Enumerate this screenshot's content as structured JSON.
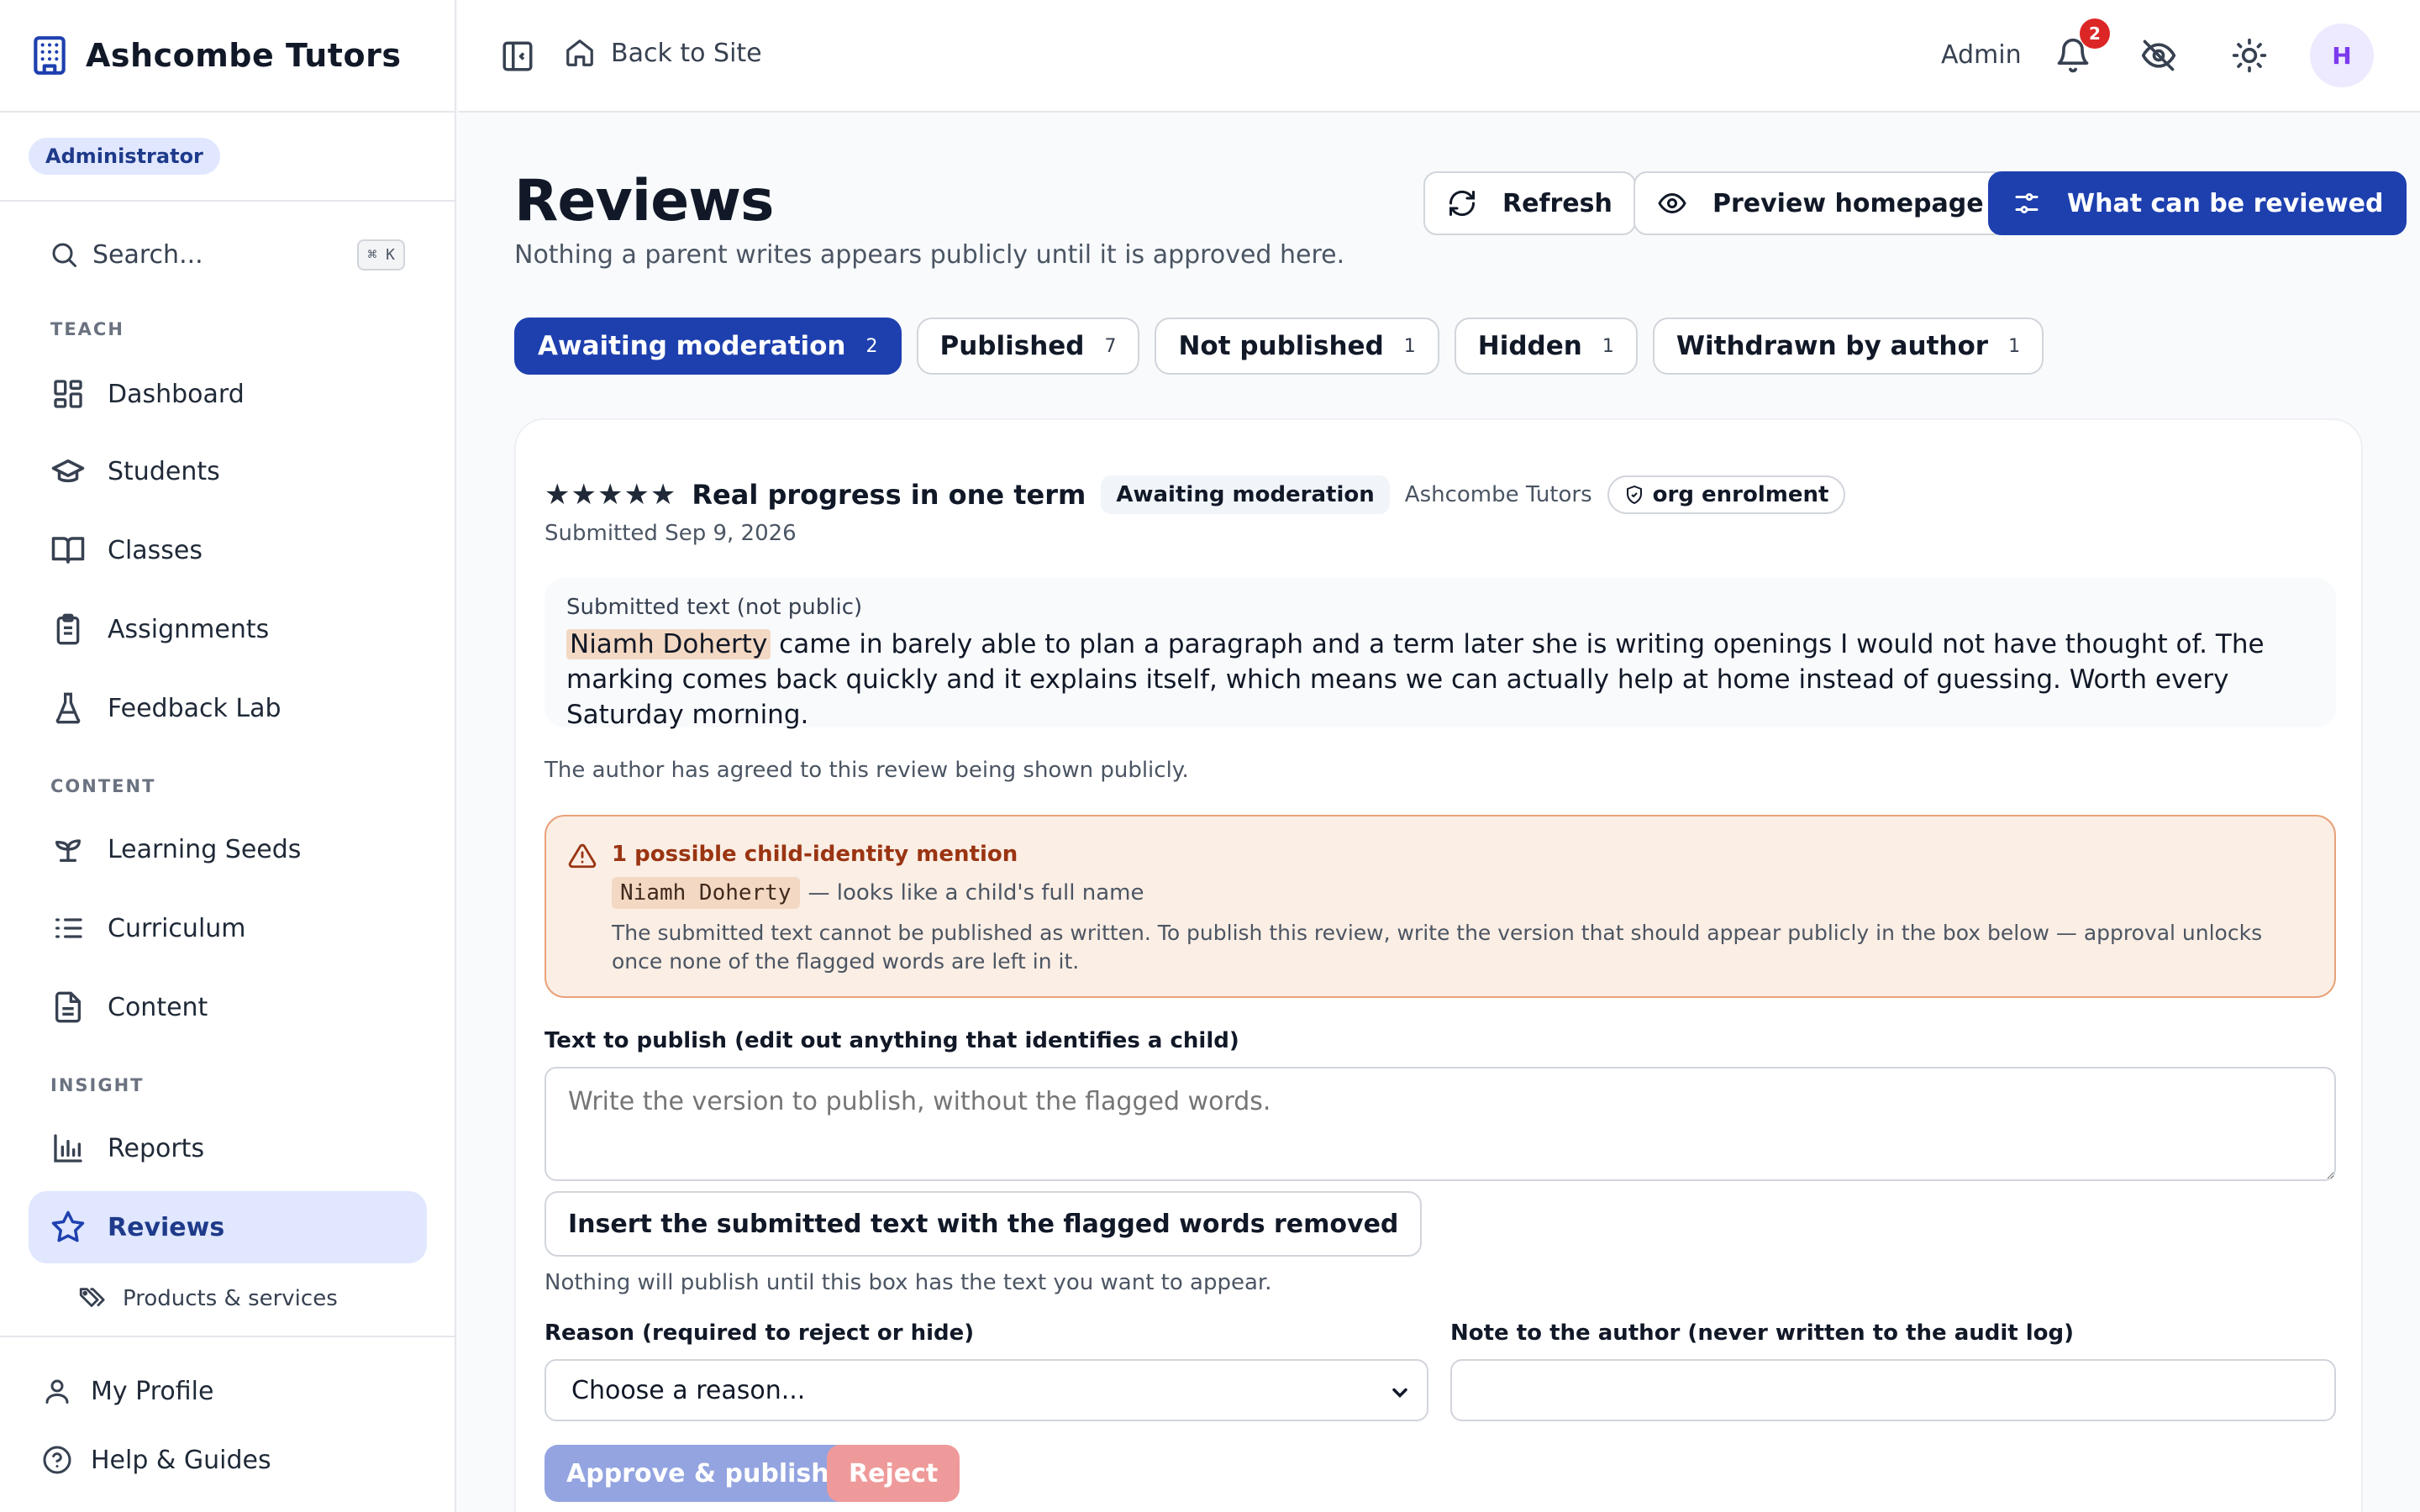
{
  "brand": {
    "name": "Ashcombe Tutors",
    "icon": "building-icon"
  },
  "sidebar": {
    "role": "Administrator",
    "search": {
      "placeholder": "Search...",
      "shortcut": "⌘ K"
    },
    "sections": {
      "teach": "TEACH",
      "content": "CONTENT",
      "insight": "INSIGHT"
    },
    "items": [
      {
        "label": "Dashboard",
        "icon": "dashboard-icon"
      },
      {
        "label": "Students",
        "icon": "graduation-cap-icon"
      },
      {
        "label": "Classes",
        "icon": "book-open-icon"
      },
      {
        "label": "Assignments",
        "icon": "clipboard-icon"
      },
      {
        "label": "Feedback Lab",
        "icon": "flask-icon"
      },
      {
        "label": "Learning Seeds",
        "icon": "sprout-icon"
      },
      {
        "label": "Curriculum",
        "icon": "list-ordered-icon"
      },
      {
        "label": "Content",
        "icon": "file-text-icon"
      },
      {
        "label": "Reports",
        "icon": "bar-chart-icon"
      },
      {
        "label": "Reviews",
        "icon": "star-icon",
        "active": true
      }
    ],
    "sub_item": {
      "label": "Products & services",
      "icon": "tags-icon"
    },
    "bottom": [
      {
        "label": "My Profile",
        "icon": "user-icon"
      },
      {
        "label": "Help & Guides",
        "icon": "help-circle-icon"
      }
    ]
  },
  "topbar": {
    "back_label": "Back to Site",
    "user_label": "Admin",
    "notification_count": "2",
    "avatar_initial": "H"
  },
  "page": {
    "title": "Reviews",
    "subtitle": "Nothing a parent writes appears publicly until it is approved here.",
    "actions": {
      "refresh": "Refresh",
      "preview": "Preview homepage",
      "what_can": "What can be reviewed"
    },
    "tabs": [
      {
        "label": "Awaiting moderation",
        "count": "2",
        "active": true
      },
      {
        "label": "Published",
        "count": "7"
      },
      {
        "label": "Not published",
        "count": "1"
      },
      {
        "label": "Hidden",
        "count": "1"
      },
      {
        "label": "Withdrawn by author",
        "count": "1"
      }
    ]
  },
  "review": {
    "stars": "★★★★★",
    "rating": 5,
    "title": "Real progress in one term",
    "status": "Awaiting moderation",
    "org": "Ashcombe Tutors",
    "source": "org enrolment",
    "submitted": "Submitted Sep 9, 2026",
    "submitted_text_label": "Submitted text (not public)",
    "flagged_name": "Niamh Doherty",
    "body_rest": " came in barely able to plan a paragraph and a term later she is writing openings I would not have thought of. The marking comes back quickly and it explains itself, which means we can actually help at home instead of guessing. Worth every Saturday morning.",
    "consent": "The author has agreed to this review being shown publicly.",
    "warning": {
      "title": "1 possible child-identity mention",
      "flagged": "Niamh Doherty",
      "note": "— looks like a child's full name",
      "description": "The submitted text cannot be published as written. To publish this review, write the version that should appear publicly in the box below — approval unlocks once none of the flagged words are left in it."
    },
    "publish_label": "Text to publish (edit out anything that identifies a child)",
    "publish_placeholder": "Write the version to publish, without the flagged words.",
    "insert_button": "Insert the submitted text with the flagged words removed",
    "helper": "Nothing will publish until this box has the text you want to appear.",
    "reason_label": "Reason (required to reject or hide)",
    "reason_value": "Choose a reason...",
    "note_label": "Note to the author (never written to the audit log)",
    "approve": "Approve & publish",
    "reject": "Reject"
  }
}
